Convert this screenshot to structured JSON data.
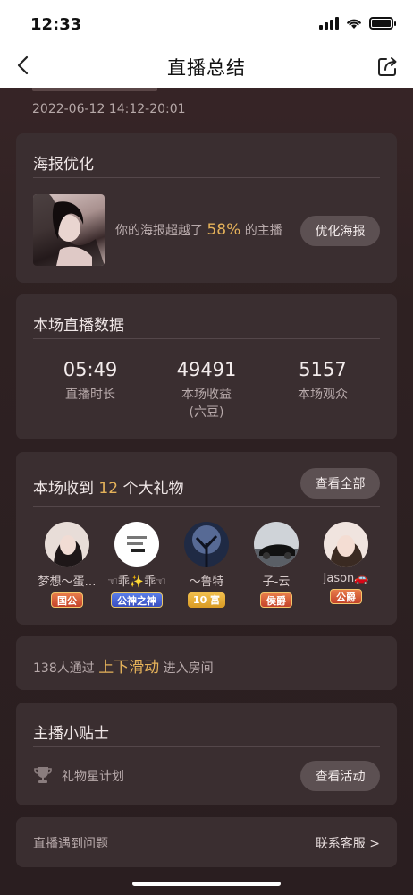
{
  "status": {
    "time": "12:33"
  },
  "nav": {
    "title": "直播总结"
  },
  "header": {
    "datetime": "2022-06-12 14:12-20:01"
  },
  "poster": {
    "title": "海报优化",
    "text_prefix": "你的海报超越了",
    "percent": "58%",
    "text_suffix": "的主播",
    "button": "优化海报"
  },
  "live_data": {
    "title": "本场直播数据",
    "stats": [
      {
        "value": "05:49",
        "label": "直播时长",
        "sub": ""
      },
      {
        "value": "49491",
        "label": "本场收益",
        "sub": "(六豆)"
      },
      {
        "value": "5157",
        "label": "本场观众",
        "sub": ""
      }
    ]
  },
  "gifts": {
    "title_prefix": "本场收到",
    "count": "12",
    "title_suffix": "个大礼物",
    "button": "查看全部",
    "users": [
      {
        "name": "梦想～蛋…",
        "badge": "国公",
        "badge_style": "red"
      },
      {
        "name": "☜乖✨乖☜",
        "badge": "公神之神",
        "badge_style": "blue"
      },
      {
        "name": "～鲁特",
        "badge": "10 富",
        "badge_style": "gold"
      },
      {
        "name": "子-云",
        "badge": "侯爵",
        "badge_style": "red"
      },
      {
        "name": "Jason🚗",
        "badge": "公爵",
        "badge_style": "red"
      }
    ]
  },
  "entry": {
    "prefix": "138人通过",
    "highlight": "上下滑动",
    "suffix": "进入房间"
  },
  "tips": {
    "title": "主播小贴士",
    "item": "礼物星计划",
    "button": "查看活动"
  },
  "help": {
    "label": "直播遇到问题",
    "link": "联系客服 >"
  },
  "colors": {
    "accent": "#e5b25a",
    "card_bg": "#3a2e30",
    "page_bg": "#2e2122"
  }
}
